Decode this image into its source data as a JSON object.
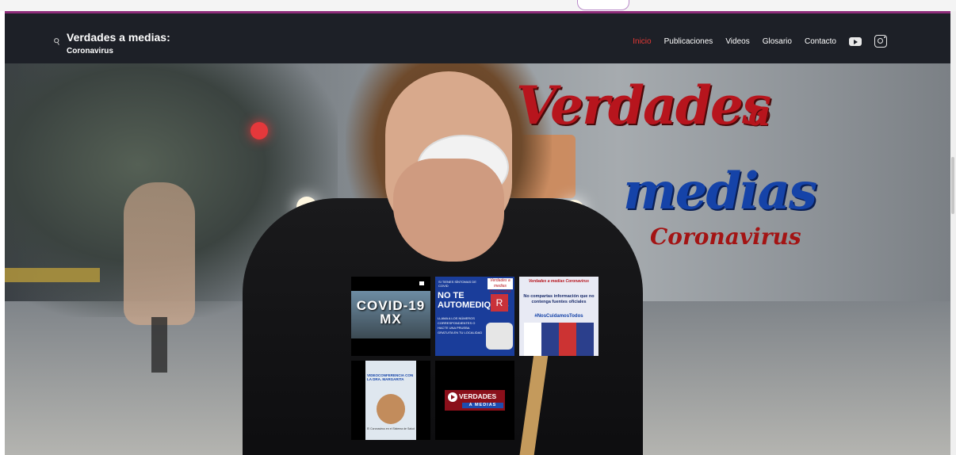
{
  "header": {
    "brand_title": "Verdades a medias:",
    "brand_subtitle": "Coronavirus",
    "nav": [
      "Inicio",
      "Publicaciones",
      "Videos",
      "Glosario",
      "Contacto"
    ],
    "active": "Inicio",
    "social_icons": [
      "youtube-icon",
      "instagram-icon"
    ]
  },
  "hero": {
    "title_line1": "Verdades",
    "title_line1b": "a",
    "title_line2": "medias",
    "title_line3": "Coronavirus"
  },
  "gallery": {
    "tile1": {
      "text_line1": "COVID-19",
      "text_line2": "MX"
    },
    "tile2": {
      "top_text": "SI TIENES SÍNTOMAS DE COVID",
      "headline": "NO TE AUTOMEDIQUES",
      "badge": "Verdades a medias Coronavirus",
      "body": "LLAMA A LOS NÚMEROS CORRESPONDIENTES O HACTE UNA PRUEBA GRATUITA EN TU LOCALIDAD",
      "rx": "R"
    },
    "tile3": {
      "brand": "Verdades a medias Coronavirus",
      "message": "No compartas información que no contenga fuentes oficiales",
      "hashtag": "#NosCuidamosTodos"
    },
    "tile4": {
      "title": "VIDEOCONFERENCIA CON LA DRA. MARGARITA",
      "footer": "El Coronavirus en el Sistema de Salud"
    },
    "tile5": {
      "line1": "VERDADES",
      "line2": "A MEDIAS"
    }
  },
  "colors": {
    "header_bg": "#1d2027",
    "accent_border": "#8e2c7a",
    "active_nav": "#e53935",
    "title_red": "#b7151d",
    "title_blue": "#1543a8"
  }
}
